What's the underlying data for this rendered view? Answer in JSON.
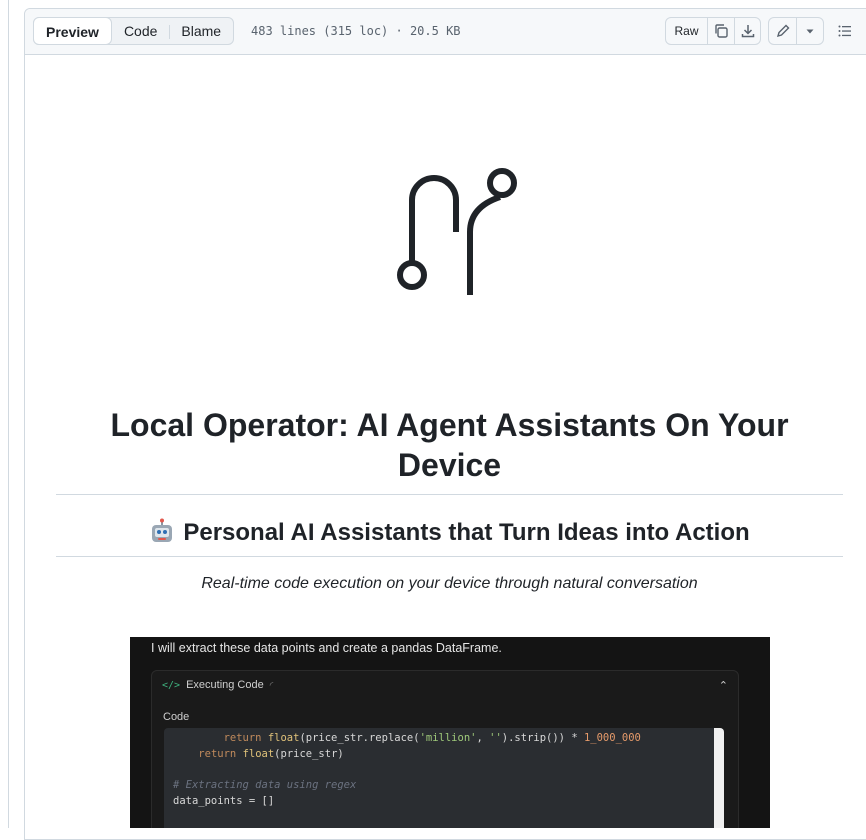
{
  "header": {
    "tabs": [
      "Preview",
      "Code",
      "Blame"
    ],
    "active_tab": "Preview",
    "file_meta": "483 lines (315 loc) · 20.5 KB",
    "raw_label": "Raw"
  },
  "readme": {
    "title_line1": "Local Operator: AI Agent Assistants On Your",
    "title_line2": "Device",
    "subtitle": "Personal AI Assistants that Turn Ideas into Action",
    "tagline": "Real-time code execution on your device through natural conversation"
  },
  "screenshot": {
    "intro": "I will extract these data points and create a pandas DataFrame.",
    "exec_title": "Executing Code",
    "code_label": "Code",
    "code_lines": [
      {
        "indent": "        ",
        "kw": "return ",
        "fn": "float",
        "rest1": "(price_str.replace(",
        "str1": "'million'",
        "rest2": ", ",
        "str2": "''",
        "rest3": ").strip()) * ",
        "num": "1_000_000"
      },
      {
        "indent": "    ",
        "kw": "return ",
        "fn": "float",
        "rest1": "(price_str)"
      },
      {
        "comment": "# Extracting data using regex"
      },
      {
        "plain": "data_points = []"
      }
    ]
  },
  "colors": {
    "border": "#d1d9e0",
    "header_bg": "#f6f8fa",
    "text": "#1f2328",
    "muted": "#59636e",
    "screenshot_bg": "#141414"
  }
}
